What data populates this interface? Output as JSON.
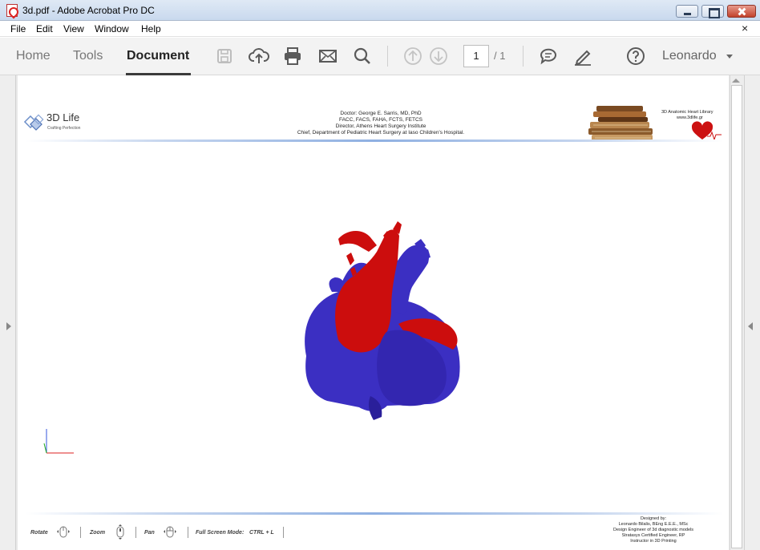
{
  "window": {
    "title": "3d.pdf - Adobe Acrobat Pro DC"
  },
  "menu": {
    "items": [
      "File",
      "Edit",
      "View",
      "Window",
      "Help"
    ],
    "close_glyph": "×"
  },
  "toolbar": {
    "tabs": [
      "Home",
      "Tools",
      "Document"
    ],
    "active_tab": "Document",
    "page_current": "1",
    "page_total": "/ 1",
    "user": "Leonardo",
    "icons": [
      "save-icon",
      "upload-icon",
      "print-icon",
      "email-icon",
      "search-icon",
      "page-up-icon",
      "page-down-icon",
      "comment-icon",
      "pen-icon",
      "help-icon"
    ]
  },
  "document": {
    "logo": {
      "title": "3D Life",
      "subtitle": "Crafting Perfection"
    },
    "header_lines": [
      "Doctor: George E. Sarris, MD, PhD",
      "FACC, FACS, FAHA, FCTS, FETCS",
      "Director, Athens Heart Surgery Institute",
      "Chief, Department of Pediatric Heart Surgery at Iaso Children's Hospital."
    ],
    "library": {
      "title": "3D Anatomic Heart Library",
      "url": "www.3dlife.gr"
    },
    "controls": [
      {
        "label": "Rotate"
      },
      {
        "label": "Zoom"
      },
      {
        "label": "Pan"
      }
    ],
    "fullscreen_label": "Full Screen Mode:",
    "fullscreen_keys": "CTRL + L",
    "designer_lines": [
      "Designed by:",
      "Leonardo Bilalis, BEng E.E.E., MSc",
      "Design Engineer of 3d diagnostic models",
      "Stratasys Certified Engineer, RP",
      "Instructor in 3D Printing"
    ]
  },
  "colors": {
    "artery_red": "#cc0d0d",
    "vein_blue": "#3b2fc2",
    "accent_blue": "#8fb0e2"
  }
}
